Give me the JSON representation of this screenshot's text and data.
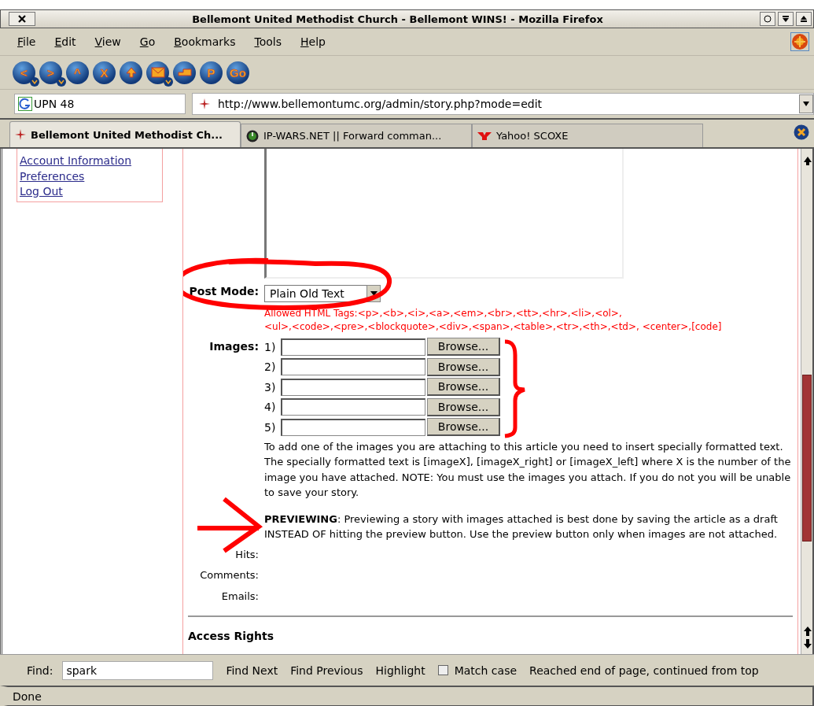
{
  "window": {
    "title": "Bellemont United Methodist Church - Bellemont WINS! - Mozilla Firefox"
  },
  "menu": [
    "File",
    "Edit",
    "View",
    "Go",
    "Bookmarks",
    "Tools",
    "Help"
  ],
  "toolbar": [
    {
      "kind": "glyph",
      "glyph": "<",
      "dropdown": true
    },
    {
      "kind": "glyph",
      "glyph": ">",
      "dropdown": true
    },
    {
      "kind": "glyph",
      "glyph": "^",
      "dropdown": false
    },
    {
      "kind": "glyph",
      "glyph": "X",
      "dropdown": false
    },
    {
      "kind": "home",
      "dropdown": false
    },
    {
      "kind": "mail",
      "dropdown": true
    },
    {
      "kind": "tray",
      "dropdown": false
    },
    {
      "kind": "glyph",
      "glyph": "P",
      "dropdown": false
    },
    {
      "kind": "glyph",
      "glyph": "Go",
      "dropdown": false
    }
  ],
  "search": {
    "value": "UPN 48"
  },
  "address": {
    "value": "http://www.bellemontumc.org/admin/story.php?mode=edit"
  },
  "tabs": [
    {
      "label": "Bellemont United Methodist Ch...",
      "selected": true,
      "kind": "compass"
    },
    {
      "label": "IP-WARS.NET || Forward comman...",
      "selected": false,
      "kind": "power"
    },
    {
      "label": "Yahoo! SCOXE",
      "selected": false,
      "kind": "y"
    }
  ],
  "sidebar": {
    "links": [
      "Account Information",
      "Preferences",
      "Log Out"
    ]
  },
  "form": {
    "post_mode": {
      "label": "Post Mode:",
      "value": "Plain Old Text"
    },
    "allowed_tags": [
      "Allowed HTML Tags:<p>,<b>,<i>,<a>,<em>,<br>,<tt>,<hr>,<li>,<ol>,",
      "<ul>,<code>,<pre>,<blockquote>,<div>,<span>,<table>,<tr>,<th>,<td>, <center>,[code]"
    ],
    "images": {
      "label": "Images:",
      "rows": [
        {
          "number": "1)",
          "button": "Browse..."
        },
        {
          "number": "2)",
          "button": "Browse..."
        },
        {
          "number": "3)",
          "button": "Browse..."
        },
        {
          "number": "4)",
          "button": "Browse..."
        },
        {
          "number": "5)",
          "button": "Browse..."
        }
      ]
    },
    "help": "To add one of the images you are attaching to this article you need to insert specially formatted text. The specially formatted text is [imageX], [imageX_right] or [imageX_left] where X is the number of the image you have attached. NOTE: You must use the images you attach. If you do not you will be unable to save your story.",
    "previewing": "**PREVIEWING**: Previewing a story with images attached is best done by saving the article as a draft INSTEAD OF hitting the preview button. Use the preview button only when images are not attached.",
    "stats": [
      "Hits:",
      "Comments:",
      "Emails:"
    ],
    "section": "Access Rights"
  },
  "find_bar": {
    "label": "Find:",
    "value": "spark",
    "buttons": [
      "Find Next",
      "Find Previous",
      "Highlight"
    ],
    "match_case": {
      "label": "Match case",
      "checked": false
    },
    "message": "Reached end of page, continued from top"
  },
  "status_bar": "Done"
}
